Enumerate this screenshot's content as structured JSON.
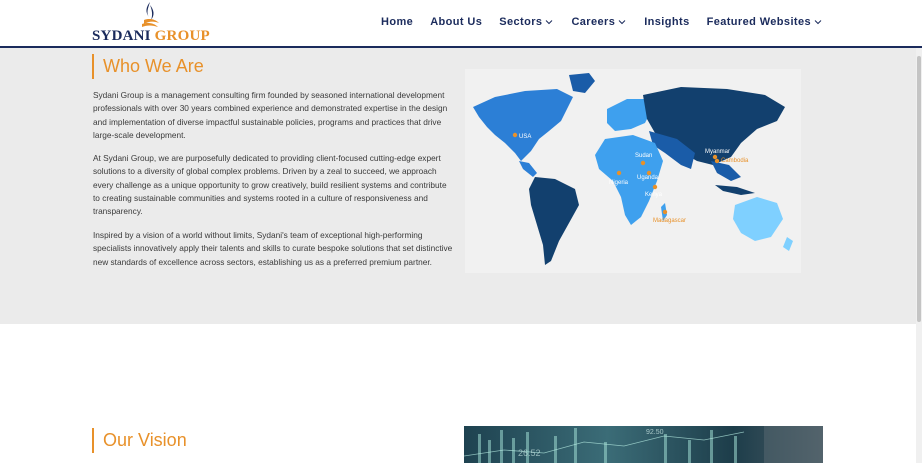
{
  "brand": {
    "name_part1": "SYDANI",
    "name_part2": "GROUP",
    "primary_color": "#1b2b5c",
    "accent_color": "#e8912a"
  },
  "nav": {
    "items": [
      {
        "label": "Home",
        "has_dropdown": false
      },
      {
        "label": "About Us",
        "has_dropdown": false
      },
      {
        "label": "Sectors",
        "has_dropdown": true
      },
      {
        "label": "Careers",
        "has_dropdown": true
      },
      {
        "label": "Insights",
        "has_dropdown": false
      },
      {
        "label": "Featured Websites",
        "has_dropdown": true
      }
    ]
  },
  "who_we_are": {
    "title": "Who We Are",
    "paragraphs": [
      "Sydani Group is a management consulting firm founded by seasoned international development professionals with over 30 years combined experience and demonstrated expertise in the design and implementation of diverse impactful sustainable policies, programs and practices that drive large-scale development.",
      "At Sydani Group, we are purposefully dedicated to providing client-focused cutting-edge expert solutions to a diversity of global complex problems. Driven by a zeal to succeed, we approach every challenge as a unique opportunity to grow creatively, build resilient systems and contribute to creating sustainable communities and systems rooted in a culture of responsiveness and transparency.",
      "Inspired by a vision of a world without limits, Sydani's team of exceptional high-performing specialists innovatively apply their talents and skills to curate bespoke solutions that set distinctive new standards of excellence across sectors, establishing us as a preferred premium partner."
    ],
    "map_locations": [
      "USA",
      "Sudan",
      "Nigeria",
      "Uganda",
      "Kenya",
      "Madagascar",
      "Myanmar",
      "Cambodia"
    ]
  },
  "vision": {
    "title": "Our Vision",
    "image_numbers": [
      "92.50",
      "26.52"
    ]
  }
}
